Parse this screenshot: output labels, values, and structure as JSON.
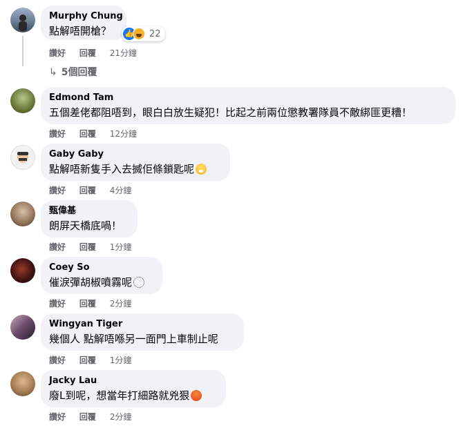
{
  "comments": [
    {
      "name": "Murphy Chung",
      "text": "點解唔開槍？",
      "like": "讚好",
      "reply": "回覆",
      "time": "21分鐘",
      "reaction_count": "22",
      "avatar_color": "#5a6f84"
    },
    {
      "name": "Edmond Tam",
      "text": "五個差佬都阻唔到，眼白白放生疑犯！比起之前兩位懲教署隊員不敵綁匪更糟！",
      "like": "讚好",
      "reply": "回覆",
      "time": "12分鐘",
      "avatar_color": "#6b7a3a"
    },
    {
      "name": "Gaby Gaby",
      "text": "點解唔新隻手入去搣佢條鎖匙呢",
      "like": "讚好",
      "reply": "回覆",
      "time": "4分鐘",
      "avatar_color": "#e8e8e8",
      "emoji": "fear-icon"
    },
    {
      "name": "甄偉基",
      "text": "朗屏天橋底喎！",
      "like": "讚好",
      "reply": "回覆",
      "time": "1分鐘",
      "avatar_color": "#8a7a6a"
    },
    {
      "name": "Coey So",
      "text": "催淚彈胡椒噴霧呢",
      "like": "讚好",
      "reply": "回覆",
      "time": "2分鐘",
      "avatar_color": "#3a1a1a",
      "emoji": "blank-emoji-icon"
    },
    {
      "name": "Wingyan Tiger",
      "text": "幾個人 點解唔喺另一面門上車制止呢",
      "like": "讚好",
      "reply": "回覆",
      "time": "1分鐘",
      "avatar_color": "#4a3a4a"
    },
    {
      "name": "Jacky Lau",
      "text": "廢L到呢，想當年打細路就兇狠",
      "like": "讚好",
      "reply": "回覆",
      "time": "2分鐘",
      "avatar_color": "#8a6a4a",
      "emoji": "angry-icon"
    }
  ],
  "replies_link": "5個回覆"
}
